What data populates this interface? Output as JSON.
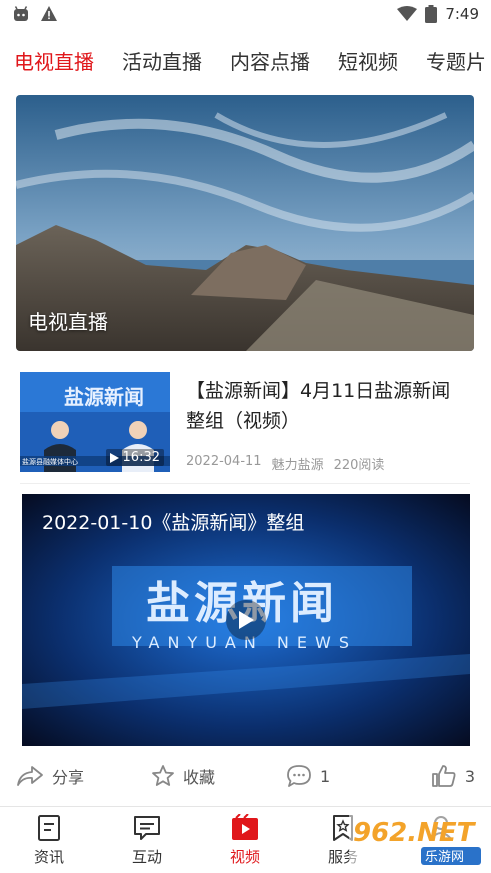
{
  "status_bar": {
    "time": "7:49"
  },
  "tabs": [
    {
      "label": "电视直播",
      "active": true
    },
    {
      "label": "活动直播",
      "active": false
    },
    {
      "label": "内容点播",
      "active": false
    },
    {
      "label": "短视频",
      "active": false
    },
    {
      "label": "专题片",
      "active": false
    }
  ],
  "hero": {
    "label": "电视直播"
  },
  "news_item": {
    "title": "【盐源新闻】4月11日盐源新闻整组（视频）",
    "duration": "16:32",
    "date": "2022-04-11",
    "source": "魅力盐源",
    "reads": "220阅读",
    "thumb_text": "盐源新闻",
    "thumb_caption": "盐源县融媒体中心"
  },
  "video_card": {
    "title": "2022-01-10《盐源新闻》整组",
    "logo_text": "盐源新闻",
    "logo_sub": "YANYUAN NEWS"
  },
  "actions": {
    "share": "分享",
    "favorite": "收藏",
    "comment_count": "1",
    "like_count": "3"
  },
  "bottom_nav": [
    {
      "label": "资讯",
      "icon": "document-icon",
      "active": false
    },
    {
      "label": "互动",
      "icon": "chat-icon",
      "active": false
    },
    {
      "label": "视频",
      "icon": "play-icon",
      "active": true
    },
    {
      "label": "服务",
      "icon": "bookmark-icon",
      "active": false
    },
    {
      "label": "我的",
      "icon": "user-icon",
      "active": false
    }
  ],
  "watermark": {
    "brand": "962.NET",
    "sub": "乐游网"
  },
  "colors": {
    "accent": "#e0171b",
    "text": "#222222",
    "muted": "#999999"
  }
}
